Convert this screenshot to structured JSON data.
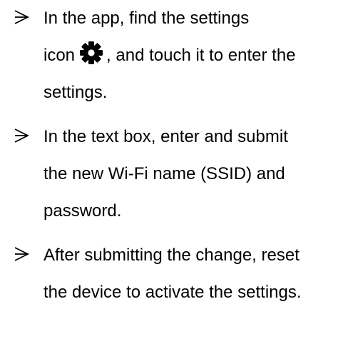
{
  "instructions": [
    {
      "lines": [
        "In the app, find the settings"
      ],
      "inline_line": {
        "before_icon": "icon",
        "icon": "gear-icon",
        "after_icon": ", and touch it to enter the"
      },
      "after_lines": [
        "settings."
      ]
    },
    {
      "lines": [
        "In the text box, enter and submit",
        "the new Wi-Fi name (SSID) and",
        "password."
      ]
    },
    {
      "lines": [
        "After submitting the change, reset",
        "the device to activate the settings."
      ]
    }
  ],
  "bullet_icon": "arrow-bullet-icon"
}
